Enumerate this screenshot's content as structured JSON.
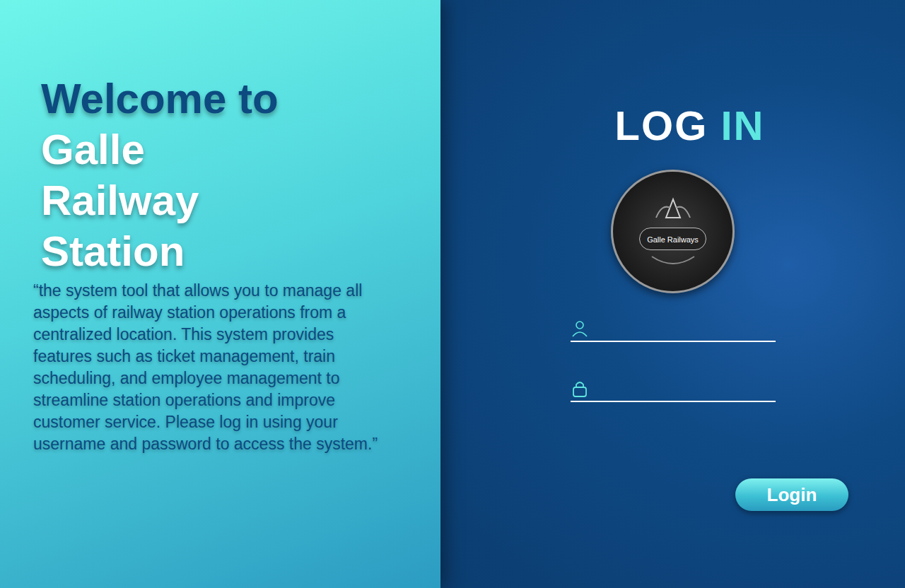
{
  "welcome": {
    "first": "Welcome to",
    "rest": [
      "Galle",
      "Railway",
      "Station"
    ]
  },
  "description": "“the system tool that allows you to manage all aspects of railway station operations from a centralized location. This system provides features such as ticket management, train scheduling, and employee management to streamline station operations and improve customer service. Please log in using your username and password to access the system.”",
  "login": {
    "title_first": "LOG",
    "title_second": "IN",
    "logo_text": "Galle Railways",
    "fields": [
      {
        "kind": "user"
      },
      {
        "kind": "lock"
      }
    ],
    "button": "Login"
  }
}
